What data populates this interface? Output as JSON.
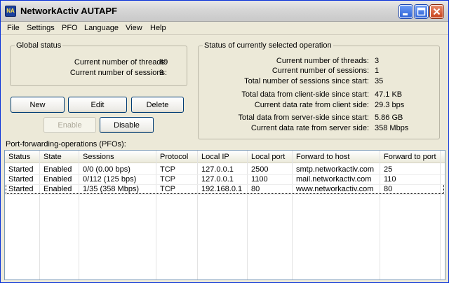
{
  "window": {
    "title": "NetworkActiv AUTAPF",
    "icon": "app-icon"
  },
  "menu": [
    "File",
    "Settings",
    "PFO",
    "Language",
    "View",
    "Help"
  ],
  "global_status": {
    "title": "Global status",
    "threads_label": "Current number of threads:",
    "threads_value": "49",
    "sessions_label": "Current number of sessions:",
    "sessions_value": "9"
  },
  "selected_status": {
    "title": "Status of currently selected operation",
    "items": [
      {
        "label": "Current number of threads:",
        "value": "3"
      },
      {
        "label": "Current number of sessions:",
        "value": "1"
      },
      {
        "label": "Total number of sessions since start:",
        "value": "35"
      },
      {
        "label": "Total data from client-side since start:",
        "value": "47.1 KB"
      },
      {
        "label": "Current data rate from client side:",
        "value": "29.3 bps"
      },
      {
        "label": "Total data from server-side since start:",
        "value": "5.86 GB"
      },
      {
        "label": "Current data rate from server side:",
        "value": "358 Mbps"
      }
    ]
  },
  "buttons": {
    "new": "New",
    "edit": "Edit",
    "delete": "Delete",
    "enable": "Enable",
    "disable": "Disable"
  },
  "pfo_label": "Port-forwarding-operations (PFOs):",
  "table": {
    "columns": [
      "Status",
      "State",
      "Sessions",
      "Protocol",
      "Local IP",
      "Local port",
      "Forward to host",
      "Forward to port"
    ],
    "rows": [
      [
        "Started",
        "Enabled",
        "0/0 (0.00 bps)",
        "TCP",
        "127.0.0.1",
        "2500",
        "smtp.networkactiv.com",
        "25"
      ],
      [
        "Started",
        "Enabled",
        "0/112 (125 bps)",
        "TCP",
        "127.0.0.1",
        "1100",
        "mail.networkactiv.com",
        "110"
      ],
      [
        "Started",
        "Enabled",
        "1/35 (358 Mbps)",
        "TCP",
        "192.168.0.1",
        "80",
        "www.networkactiv.com",
        "80"
      ]
    ],
    "selected_row": 2
  }
}
